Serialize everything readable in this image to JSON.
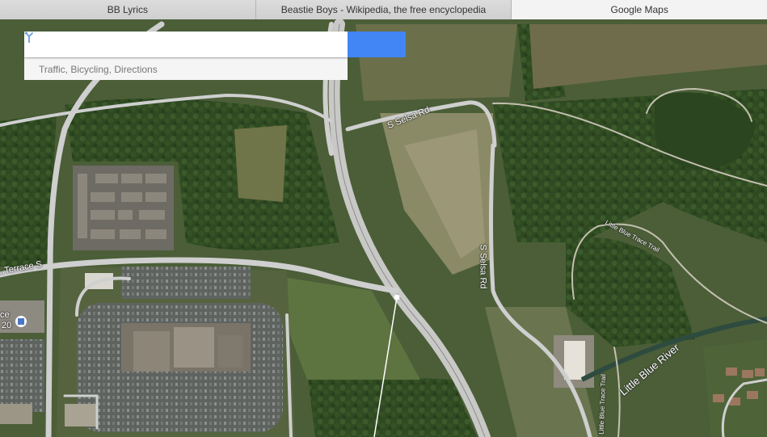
{
  "tabs": [
    {
      "label": "BB Lyrics",
      "active": false
    },
    {
      "label": "Beastie Boys - Wikipedia, the free encyclopedia",
      "active": false
    },
    {
      "label": "Google Maps",
      "active": true
    }
  ],
  "search": {
    "value": "",
    "placeholder": "",
    "button_icon": "search-icon",
    "suggestion": "Traffic, Bicycling, Directions",
    "suggestion_icon": "directions-icon"
  },
  "map": {
    "view": "satellite",
    "labels": {
      "selsa_top": "S Selsa Rd",
      "selsa_side": "S Selsa Rd",
      "little_blue_trace_top": "Little Blue Trace Trail",
      "little_blue_trace_bottom": "Little Blue Trace Trail",
      "little_blue_river": "Little Blue River",
      "terrace": "...Terrace S",
      "left_edge_a": "ce",
      "left_edge_b": "20"
    }
  },
  "colors": {
    "accent": "#4285f4",
    "road": "#cfcfcf"
  }
}
